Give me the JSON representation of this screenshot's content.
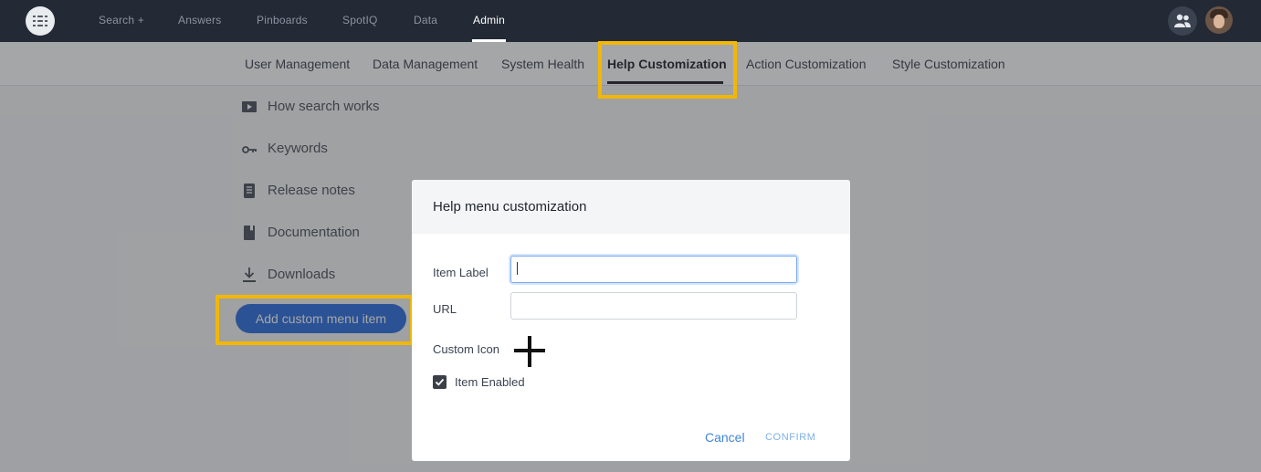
{
  "top_nav": {
    "logo_icon": "thoughtspot-logo",
    "links": [
      "Search +",
      "Answers",
      "Pinboards",
      "SpotIQ",
      "Data",
      "Admin"
    ],
    "active": "Admin",
    "users_icon": "users-icon",
    "avatar_icon": "user-avatar"
  },
  "sub_nav": {
    "tabs": [
      "User Management",
      "Data Management",
      "System Health",
      "Help Customization",
      "Action Customization",
      "Style Customization"
    ],
    "active": "Help Customization"
  },
  "help_menu": {
    "items": [
      {
        "label": "How search works",
        "icon": "video-play-icon"
      },
      {
        "label": "Keywords",
        "icon": "key-icon"
      },
      {
        "label": "Release notes",
        "icon": "document-icon"
      },
      {
        "label": "Documentation",
        "icon": "book-icon"
      },
      {
        "label": "Downloads",
        "icon": "download-icon"
      }
    ],
    "add_button": "Add custom menu item"
  },
  "modal": {
    "title": "Help menu customization",
    "item_label": "Item Label",
    "item_label_value": "",
    "url_label": "URL",
    "url_value": "",
    "custom_icon_label": "Custom Icon",
    "custom_icon_action": "plus-icon",
    "item_enabled_label": "Item Enabled",
    "item_enabled": true,
    "cancel": "Cancel",
    "confirm": "CONFIRM"
  },
  "colors": {
    "topnav": "#232a35",
    "accent": "#2d6fe0",
    "highlight": "#f2b705",
    "link": "#3f86d9"
  }
}
